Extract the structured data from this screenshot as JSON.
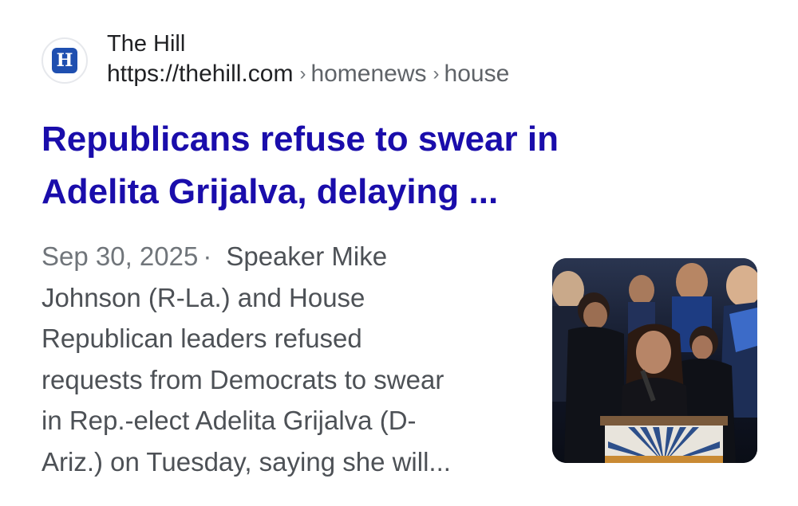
{
  "result": {
    "site_name": "The Hill",
    "favicon_letter": "H",
    "url_base": "https://thehill.com",
    "url_separator": "›",
    "url_path": [
      "homenews",
      "house"
    ],
    "title_lines": [
      "Republicans refuse to swear in",
      "Adelita Grijalva, delaying ..."
    ],
    "date": "Sep 30, 2025",
    "date_separator": "·",
    "snippet_lines": [
      "Speaker Mike",
      "Johnson (R-La.) and House",
      "Republican leaders refused",
      "requests from Democrats to swear",
      "in Rep.-elect Adelita Grijalva (D-",
      "Ariz.) on Tuesday, saying she will..."
    ]
  },
  "thumbnail": {
    "subject": "woman-speaking-at-podium-with-crowd",
    "podium_emblem": "sunburst"
  },
  "colors": {
    "title_link": "#1a0dab",
    "favicon_bg": "#1f4fb0",
    "text_secondary": "#4d5156"
  }
}
